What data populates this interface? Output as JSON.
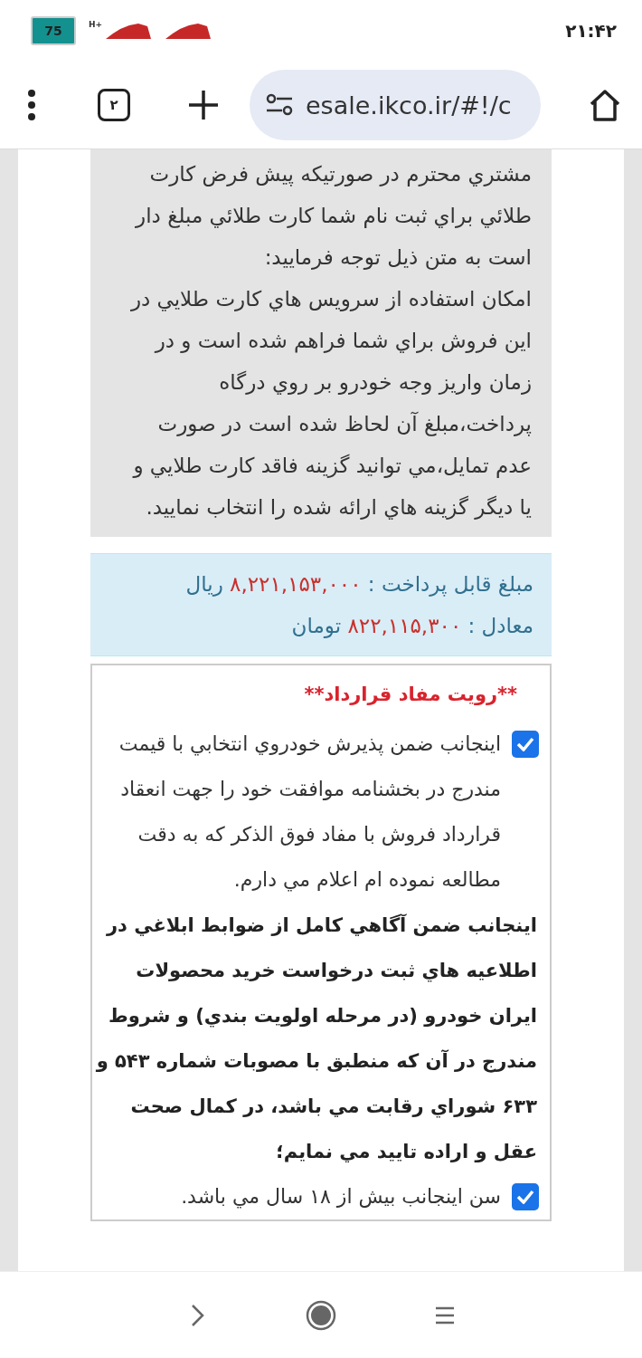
{
  "status_bar": {
    "battery": "75",
    "network": "H+",
    "time": "۲۱:۴۲"
  },
  "browser": {
    "tab_count": "۲",
    "url": "esale.ikco.ir/#!/c"
  },
  "notice": {
    "paragraphs": [
      "مشتري محترم در صورتيکه پيش فرض کارت طلائي براي ثبت نام شما کارت طلائي مبلغ دار است به متن ذيل توجه فرماييد:",
      "امکان استفاده از سرويس هاي کارت طلايي در اين فروش براي شما فراهم شده است و در زمان واريز وجه خودرو بر روي درگاه پرداخت،مبلغ آن لحاظ شده است در صورت عدم تمايل،مي توانيد گزينه فاقد کارت طلايي و يا ديگر گزينه هاي ارائه شده را انتخاب نماييد."
    ]
  },
  "amount": [
    {
      "label": "مبلغ قابل پرداخت :",
      "value": "۸,۲۲۱,۱۵۳,۰۰۰",
      "unit": "ريال"
    },
    {
      "label": "معادل :",
      "value": "۸۲۲,۱۱۵,۳۰۰",
      "unit": "تومان"
    }
  ],
  "contract": {
    "title": "**رويت مفاد قرارداد**",
    "items": [
      {
        "kind": "checkbox",
        "checked": true,
        "text": "اينجانب ضمن پذيرش خودروي انتخابي با قيمت مندرج در بخشنامه موافقت خود را جهت انعقاد قرارداد فروش با مفاد فوق الذکر که به دقت مطالعه نموده ام اعلام مي دارم."
      },
      {
        "kind": "statement",
        "text": "اينجانب ضمن آگاهي کامل از ضوابط ابلاغي در اطلاعيه هاي ثبت درخواست خريد محصولات ايران خودرو (در مرحله اولويت بندي) و شروط مندرج در آن که منطبق با مصوبات شماره ۵۴۳ و ۶۳۳ شوراي رقابت مي باشد، در کمال صحت عقل و اراده تاييد مي نمايم؛"
      },
      {
        "kind": "checkbox",
        "checked": true,
        "text": "سن اينجانب بيش از ۱۸ سال مي باشد."
      }
    ]
  }
}
